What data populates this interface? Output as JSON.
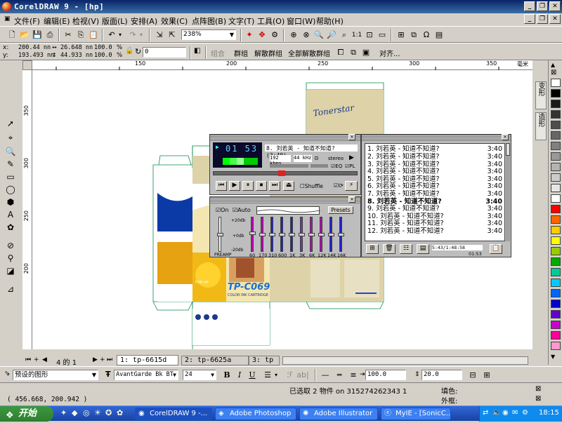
{
  "window": {
    "title": "CorelDRAW 9 - [hp]"
  },
  "menu": [
    "文件(F)",
    "编辑(E)",
    "检视(V)",
    "版面(L)",
    "安排(A)",
    "效果(C)",
    "点阵图(B)",
    "文字(T)",
    "工具(O)",
    "窗口(W)",
    "帮助(H)"
  ],
  "toolbar": {
    "zoom": "238%"
  },
  "props": {
    "x": "200.44 nn",
    "y": "193.493 nn",
    "w": "26.648 nn",
    "h": "44.933 nn",
    "sx": "100.0",
    "sy": "100.0",
    "rot": "0",
    "percent": "%",
    "group": "组合",
    "ungroup": "群组",
    "ungroup_one": "解散群组",
    "ungroup_all": "全部解散群组",
    "align": "对齐..."
  },
  "ruler": {
    "unit": "毫米",
    "h_ticks": [
      "150",
      "200",
      "250",
      "300",
      "350"
    ],
    "v_ticks": [
      "350",
      "300",
      "250",
      "200"
    ]
  },
  "pages": {
    "counter": "4 的 1",
    "tabs": [
      "1: tp-6615d",
      "2: tp-6625a",
      "3: tp"
    ]
  },
  "text_props": {
    "style": "预设的图形",
    "font": "AvantGarde Bk BT",
    "size": "24",
    "bold": "B",
    "italic": "I",
    "underline": "U",
    "scale1": "100.0",
    "scale2": "20.0"
  },
  "status": {
    "coords": "( 456.668, 200.942 )",
    "selection": "已选取 2 物件 on 315274262343 1",
    "fill_label": "填色:",
    "outline_label": "外框:"
  },
  "dockers": [
    "变形",
    "造形"
  ],
  "palette": [
    "#ffffff",
    "#000000",
    "#1a1a1a",
    "#333333",
    "#4d4d4d",
    "#666666",
    "#808080",
    "#999999",
    "#b3b3b3",
    "#cccccc",
    "#e6e6e6",
    "#ffffff",
    "#ff0000",
    "#ff6600",
    "#ffcc00",
    "#ffff00",
    "#99cc00",
    "#00aa00",
    "#00cc99",
    "#00ccff",
    "#0066ff",
    "#0000cc",
    "#6600cc",
    "#cc00cc",
    "#ff0099",
    "#ff99cc"
  ],
  "winamp": {
    "time": "01 53",
    "song": "8. 刘若英 - 知道不知道? (3:40)",
    "kbps": "192",
    "kbps_unit": "kbps",
    "khz": "44",
    "khz_unit": "kHz",
    "stereo": "stereo",
    "eq_label": "EQ",
    "pl_label": "PL",
    "shuffle": "Shuffle",
    "eq_on": "On",
    "eq_auto": "Auto",
    "presets": "Presets",
    "eq_db": [
      "+20db",
      "+0db",
      "-20db"
    ],
    "preamp": "PREAMP",
    "eq_bands": [
      "60",
      "170",
      "310",
      "600",
      "1K",
      "3K",
      "6K",
      "12K",
      "14K",
      "16K"
    ],
    "playlist": [
      {
        "title": "1. 刘若英 - 知道不知道?",
        "time": "3:40"
      },
      {
        "title": "2. 刘若英 - 知道不知道?",
        "time": "3:40"
      },
      {
        "title": "3. 刘若英 - 知道不知道?",
        "time": "3:40"
      },
      {
        "title": "4. 刘若英 - 知道不知道?",
        "time": "3:40"
      },
      {
        "title": "5. 刘若英 - 知道不知道?",
        "time": "3:40"
      },
      {
        "title": "6. 刘若英 - 知道不知道?",
        "time": "3:40"
      },
      {
        "title": "7. 刘若英 - 知道不知道?",
        "time": "3:40"
      },
      {
        "title": "8. 刘若英 - 知道不知道?",
        "time": "3:40"
      },
      {
        "title": "9. 刘若英 - 知道不知道?",
        "time": "3:40"
      },
      {
        "title": "10. 刘若英 - 知道不知道?",
        "time": "3:40"
      },
      {
        "title": "11. 刘若英 - 知道不知道?",
        "time": "3:40"
      },
      {
        "title": "12. 刘若英 - 知道不知道?",
        "time": "3:40"
      }
    ],
    "pl_info": "5:43/1:48:58",
    "pl_time": "01:53"
  },
  "artwork": {
    "brand": "TP-C069",
    "sub": "COLOR INK CARTRIDGE",
    "side": "FOR HP"
  },
  "taskbar": {
    "start": "开始",
    "tasks": [
      "CorelDRAW 9 -...",
      "Adobe Photoshop",
      "Adobe Illustrator",
      "MyIE - [SonicC..."
    ],
    "clock": "18:15"
  }
}
